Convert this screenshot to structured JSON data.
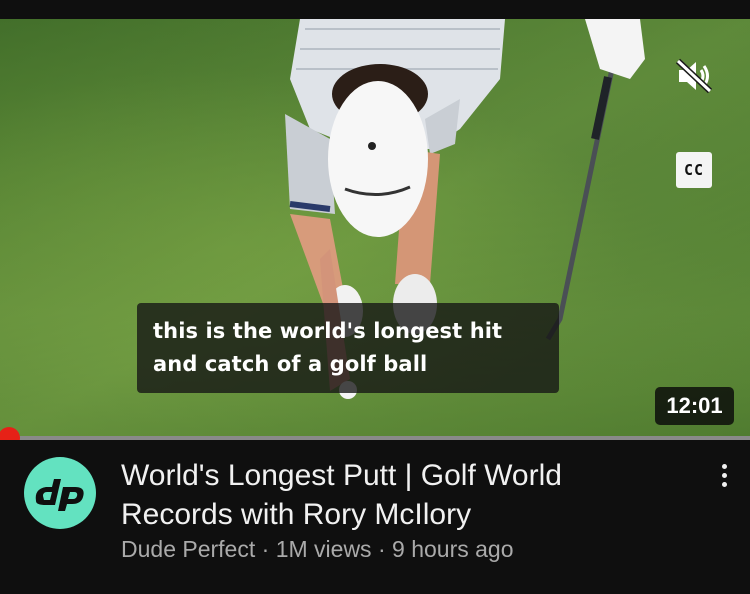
{
  "player": {
    "caption_text": "this is the world's longest hit and catch of a golf ball",
    "duration": "12:01",
    "cc_label": "CC",
    "progress_fraction": 0.01,
    "muted": true
  },
  "video": {
    "title": "World's Longest Putt | Golf World Records with Rory McIlory",
    "channel": "Dude Perfect",
    "separator": "·",
    "views": "1M views",
    "age": "9 hours ago"
  },
  "icons": {
    "mute": "volume-muted-icon",
    "captions": "closed-captions-icon",
    "more": "more-vertical-icon",
    "avatar": "dude-perfect-logo"
  },
  "colors": {
    "progress_played": "#e62117",
    "avatar_bg": "#63e2c0",
    "meta_text": "#aaaaaa"
  }
}
